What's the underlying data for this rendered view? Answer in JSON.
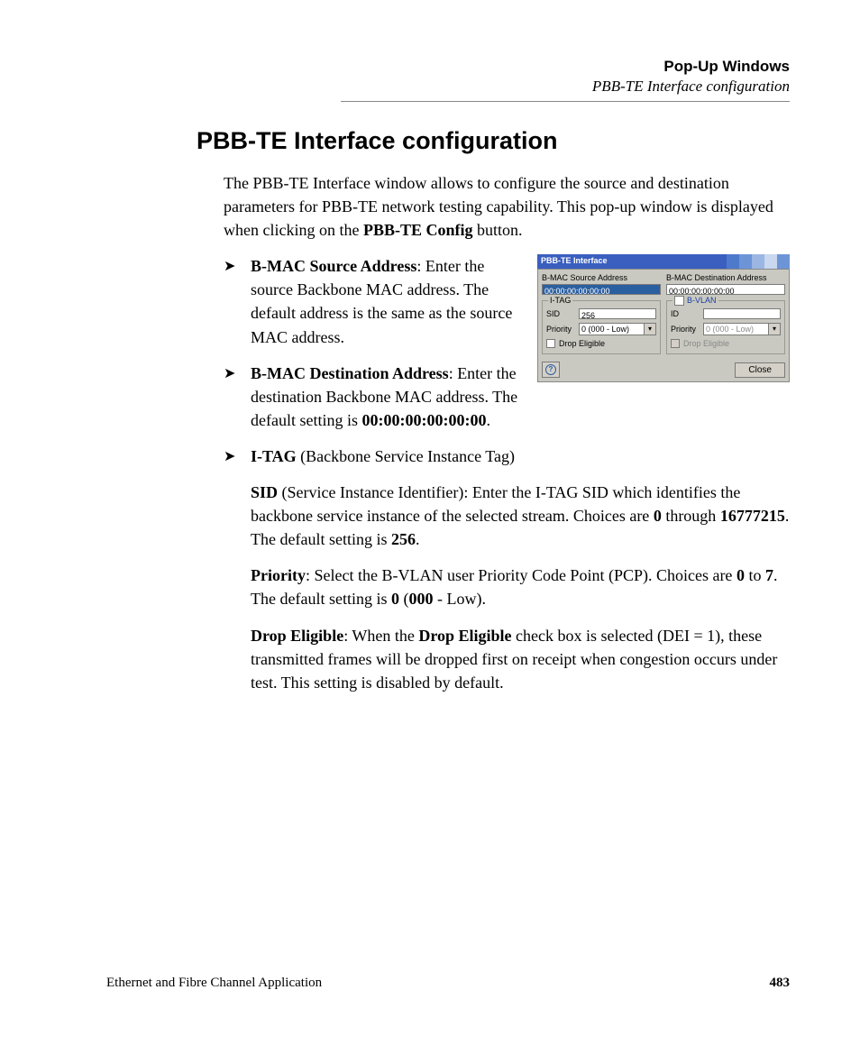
{
  "header": {
    "chapter": "Pop-Up Windows",
    "section_crumb": "PBB-TE Interface configuration"
  },
  "title": "PBB-TE Interface configuration",
  "intro": {
    "t1": "The PBB-TE Interface window allows to configure the source and destination parameters for PBB-TE network testing capability. This pop-up window is displayed when clicking on the ",
    "t2": "PBB-TE Config",
    "t3": " button."
  },
  "bullets": {
    "b1": {
      "label": "B-MAC Source Address",
      "text": ": Enter the source Backbone MAC address. The default address is the same as the source MAC address."
    },
    "b2": {
      "label": "B-MAC Destination Address",
      "text": ": Enter the destination Backbone MAC address. The default setting is ",
      "val": "00:00:00:00:00:00",
      "tail": "."
    },
    "b3": {
      "label": "I-TAG",
      "text": " (Backbone Service Instance Tag)"
    }
  },
  "subs": {
    "s1": {
      "a": "SID",
      "b": " (Service Instance Identifier): Enter the I-TAG SID which identifies the backbone service instance of the selected stream. Choices are ",
      "c": "0",
      "d": " through ",
      "e": "16777215",
      "f": ". The default setting is ",
      "g": "256",
      "h": "."
    },
    "s2": {
      "a": "Priority",
      "b": ": Select the B-VLAN user Priority Code Point (PCP). Choices are ",
      "c": "0",
      "d": " to ",
      "e": "7",
      "f": ". The default setting is ",
      "g": "0",
      "h": " (",
      "i": "000",
      "j": " - Low)."
    },
    "s3": {
      "a": "Drop Eligible",
      "b": ": When the ",
      "c": "Drop Eligible",
      "d": " check box is selected (DEI = 1), these transmitted frames will be dropped first on receipt when congestion occurs under test. This setting is disabled by default."
    }
  },
  "dialog": {
    "title": "PBB-TE Interface",
    "left": {
      "addr_label": "B-MAC Source Address",
      "addr_value": "00:00:00:00:00:00",
      "group": "I-TAG",
      "sid_label": "SID",
      "sid_value": "256",
      "prio_label": "Priority",
      "prio_value": "0 (000 - Low)",
      "drop_label": "Drop Eligible"
    },
    "right": {
      "addr_label": "B-MAC Destination Address",
      "addr_value": "00:00:00:00:00:00",
      "group": "B-VLAN",
      "id_label": "ID",
      "id_value": "",
      "prio_label": "Priority",
      "prio_value": "0 (000 - Low)",
      "drop_label": "Drop Eligible"
    },
    "help": "?",
    "close": "Close"
  },
  "footer": {
    "book": "Ethernet and Fibre Channel Application",
    "page": "483"
  }
}
